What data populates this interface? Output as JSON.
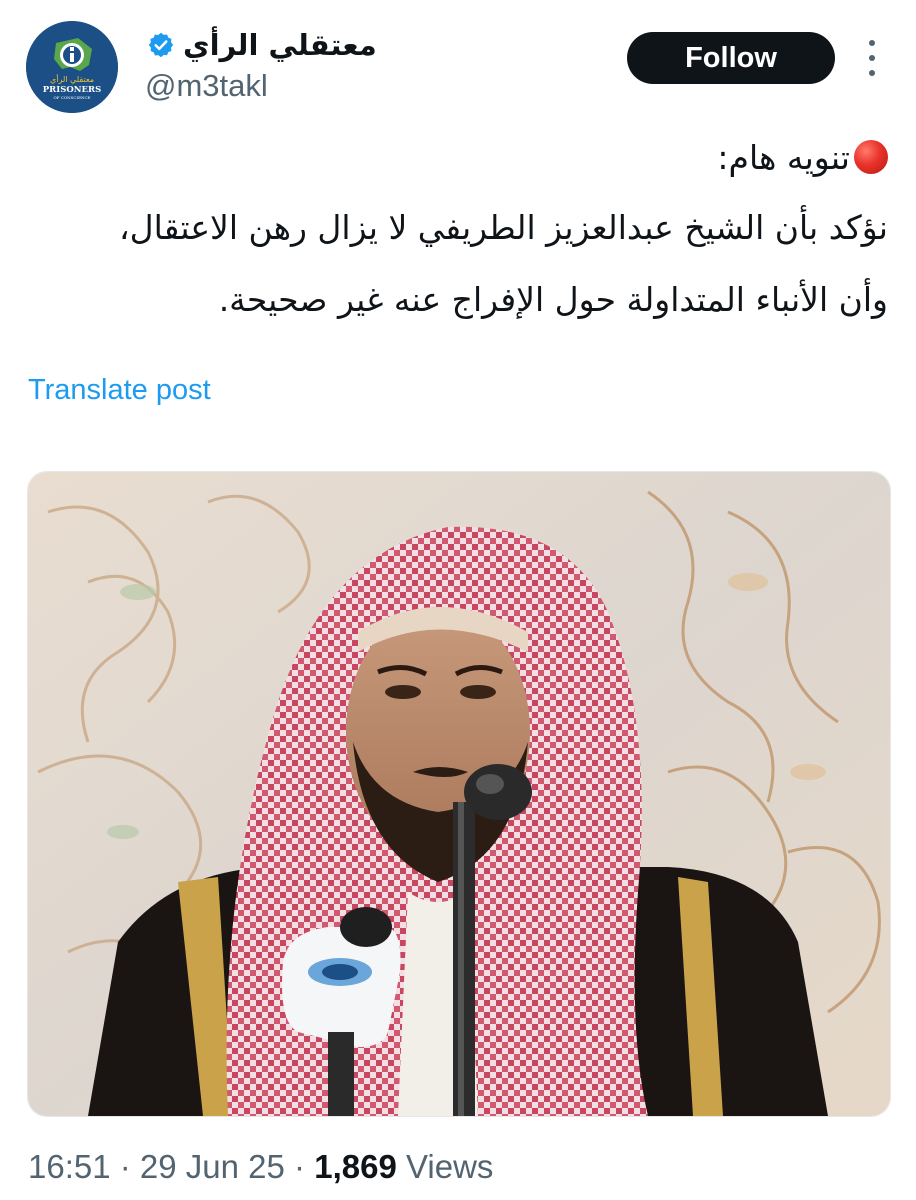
{
  "author": {
    "display_name": "معتقلي الرأي",
    "handle": "@m3takl",
    "avatar": {
      "logo_text_arabic": "معتقلي الرأي",
      "logo_text_latin": "PRISONERS",
      "logo_text_sub": "OF CONSCIENCE"
    }
  },
  "follow_label": "Follow",
  "tweet": {
    "notice": "تنويه هام:",
    "line2": "نؤكد بأن الشيخ عبدالعزيز الطريفي لا يزال رهن الاعتقال،",
    "line3": "وأن الأنباء المتداولة حول الإفراج عنه غير صحيحة."
  },
  "translate_label": "Translate post",
  "meta": {
    "time": "16:51",
    "separator1": " · ",
    "date": "29 Jun 25",
    "separator2": " · ",
    "views_count": "1,869",
    "views_label": " Views"
  },
  "icons": {
    "verified": "verified-badge-icon",
    "notice": "red-circle-icon",
    "more": "more-options-icon"
  },
  "colors": {
    "follow_bg": "#0f1419",
    "link": "#1d9bf0",
    "muted": "#536471",
    "verified": "#1d9bf0",
    "avatar_bg": "#1b4f86"
  }
}
